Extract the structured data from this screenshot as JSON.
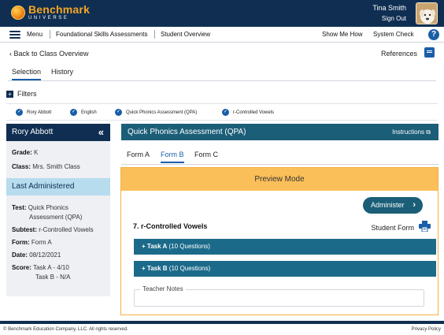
{
  "header": {
    "logo_top": "Benchmark",
    "logo_bottom": "UNIVERSE",
    "user_name": "Tina Smith",
    "sign_out": "Sign Out",
    "colors": {
      "primary": "#0f2e52",
      "accent": "#f5a623"
    }
  },
  "nav": {
    "menu_label": "Menu",
    "items": [
      "Foundational Skills Assessments",
      "Student Overview"
    ],
    "show_me_how": "Show Me How",
    "system_check": "System Check",
    "help": "?"
  },
  "page": {
    "back_label": "Back to Class Overview",
    "references_label": "References",
    "tabs": [
      "Selection",
      "History"
    ]
  },
  "filters": {
    "label": "Filters",
    "chips": [
      "Rory Abbott",
      "English",
      "Quick Phonics Assessment (QPA)",
      "r-Controlled Vowels"
    ]
  },
  "student_panel": {
    "name": "Rory Abbott",
    "collapse_icon": "«",
    "grade_label": "Grade:",
    "grade_value": "K",
    "class_label": "Class:",
    "class_value": "Mrs. Smith Class",
    "last_administered_title": "Last Administered",
    "test_label": "Test:",
    "test_value_line1": "Quick Phonics",
    "test_value_line2": "Assessment (QPA)",
    "subtest_label": "Subtest:",
    "subtest_value": "r-Controlled Vowels",
    "form_label": "Form:",
    "form_value": "Form A",
    "date_label": "Date:",
    "date_value": "08/12/2021",
    "score_label": "Score:",
    "score_line1": "Task A - 4/10",
    "score_line2": "Task B - N/A"
  },
  "assessment": {
    "title": "Quick Phonics Assessment (QPA)",
    "instructions": "Instructions",
    "form_tabs": [
      "Form A",
      "Form B",
      "Form C"
    ],
    "active_form": "Form B",
    "preview_mode": "Preview Mode",
    "administer": "Administer",
    "section_title": "7. r-Controlled Vowels",
    "student_form": "Student Form",
    "tasks": [
      {
        "name": "Task A",
        "detail": "(10 Questions)"
      },
      {
        "name": "Task B",
        "detail": "(10 Questions)"
      }
    ],
    "teacher_notes": "Teacher Notes"
  },
  "footer": {
    "copyright": "© Benchmark Education Company, LLC. All rights reserved.",
    "privacy": "Privacy Policy"
  }
}
